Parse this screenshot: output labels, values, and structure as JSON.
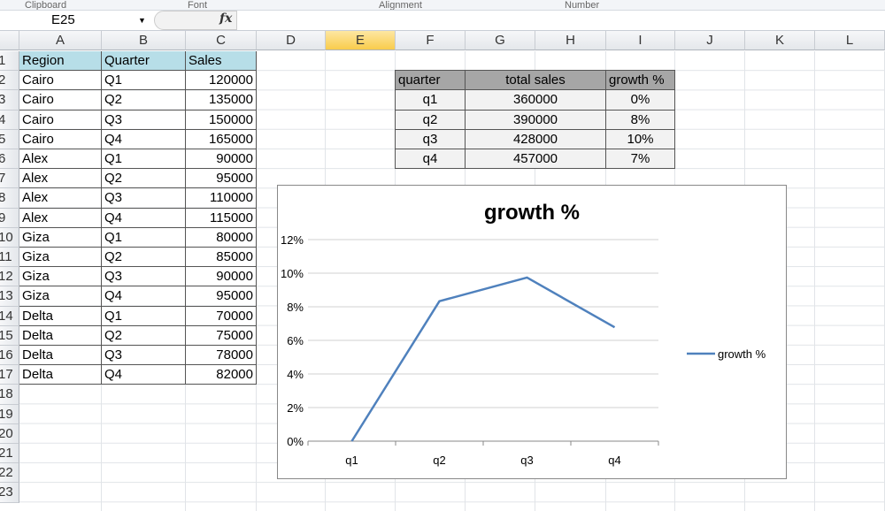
{
  "ribbon": {
    "groups": [
      "Clipboard",
      "Font",
      "Alignment",
      "Number"
    ]
  },
  "formula_bar": {
    "name_box": "E25",
    "formula": ""
  },
  "columns": [
    "A",
    "B",
    "C",
    "D",
    "E",
    "F",
    "G",
    "H",
    "I",
    "J",
    "K",
    "L"
  ],
  "selected_column": "E",
  "rows": [
    "1",
    "2",
    "3",
    "4",
    "5",
    "6",
    "7",
    "8",
    "9",
    "10",
    "11",
    "12",
    "13",
    "14",
    "15",
    "16",
    "17",
    "18",
    "19",
    "20",
    "21",
    "22",
    "23"
  ],
  "data_table": {
    "headers": [
      "Region",
      "Quarter",
      "Sales"
    ],
    "rows": [
      [
        "Cairo",
        "Q1",
        "120000"
      ],
      [
        "Cairo",
        "Q2",
        "135000"
      ],
      [
        "Cairo",
        "Q3",
        "150000"
      ],
      [
        "Cairo",
        "Q4",
        "165000"
      ],
      [
        "Alex",
        "Q1",
        "90000"
      ],
      [
        "Alex",
        "Q2",
        "95000"
      ],
      [
        "Alex",
        "Q3",
        "110000"
      ],
      [
        "Alex",
        "Q4",
        "115000"
      ],
      [
        "Giza",
        "Q1",
        "80000"
      ],
      [
        "Giza",
        "Q2",
        "85000"
      ],
      [
        "Giza",
        "Q3",
        "90000"
      ],
      [
        "Giza",
        "Q4",
        "95000"
      ],
      [
        "Delta",
        "Q1",
        "70000"
      ],
      [
        "Delta",
        "Q2",
        "75000"
      ],
      [
        "Delta",
        "Q3",
        "78000"
      ],
      [
        "Delta",
        "Q4",
        "82000"
      ]
    ]
  },
  "summary_table": {
    "headers": [
      "quarter",
      "total sales",
      "growth %"
    ],
    "rows": [
      [
        "q1",
        "360000",
        "0%"
      ],
      [
        "q2",
        "390000",
        "8%"
      ],
      [
        "q3",
        "428000",
        "10%"
      ],
      [
        "q4",
        "457000",
        "7%"
      ]
    ]
  },
  "chart_data": {
    "type": "line",
    "title": "growth %",
    "categories": [
      "q1",
      "q2",
      "q3",
      "q4"
    ],
    "series": [
      {
        "name": "growth %",
        "values": [
          0,
          8.33,
          9.74,
          6.78
        ],
        "color": "#4f81bd"
      }
    ],
    "ylim": [
      0,
      12
    ],
    "yticks": [
      0,
      2,
      4,
      6,
      8,
      10,
      12
    ],
    "ytick_labels": [
      "0%",
      "2%",
      "4%",
      "6%",
      "8%",
      "10%",
      "12%"
    ],
    "grid": true,
    "legend": "right"
  }
}
